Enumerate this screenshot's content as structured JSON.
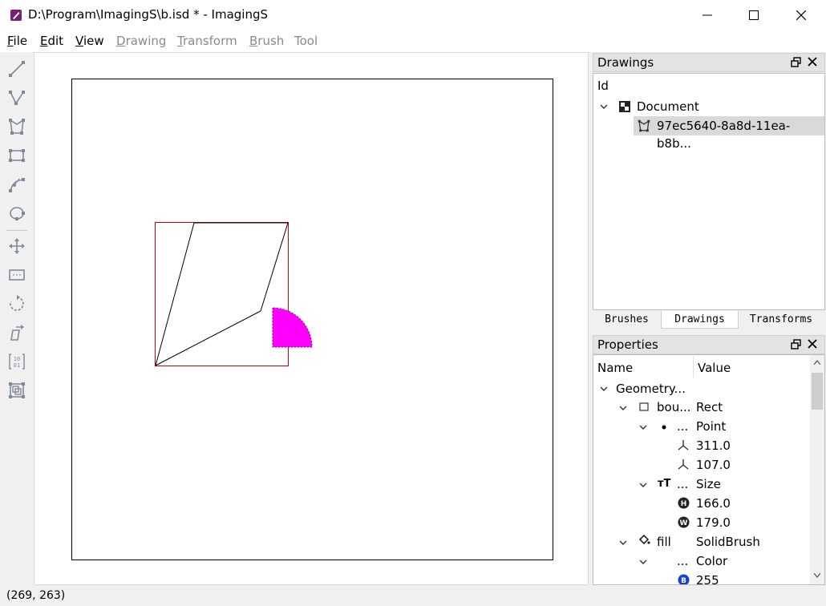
{
  "window": {
    "title": "D:\\Program\\ImagingS\\b.isd * - ImagingS"
  },
  "menu": {
    "items": [
      {
        "label": "File",
        "enabled": true
      },
      {
        "label": "Edit",
        "enabled": true
      },
      {
        "label": "View",
        "enabled": true
      },
      {
        "label": "Drawing",
        "enabled": false
      },
      {
        "label": "Transform",
        "enabled": false
      },
      {
        "label": "Brush",
        "enabled": false
      },
      {
        "label": "Tool",
        "enabled": false
      }
    ]
  },
  "toolbar": {
    "tools": [
      "line-tool-icon",
      "polyline-tool-icon",
      "polygon-tool-icon",
      "rectangle-tool-icon",
      "curve-tool-icon",
      "ellipse-tool-icon",
      "move-tool-icon",
      "clip-tool-icon",
      "rotate-tool-icon",
      "skew-tool-icon",
      "matrix-tool-icon",
      "transform-group-icon"
    ]
  },
  "canvas": {
    "selection_color": "#cc0000",
    "fill_color": "#ff00ff"
  },
  "status": {
    "coords": "(269, 263)"
  },
  "drawings_panel": {
    "title": "Drawings",
    "header": "Id",
    "root": "Document",
    "child": "97ec5640-8a8d-11ea-b8b..."
  },
  "tabs": [
    "Brushes",
    "Drawings",
    "Transforms"
  ],
  "active_tab": "Drawings",
  "properties_panel": {
    "title": "Properties",
    "col_name": "Name",
    "col_value": "Value",
    "rows": [
      {
        "name": "Geometry...",
        "value": ""
      },
      {
        "name": "bou...",
        "value": "Rect"
      },
      {
        "name": "...",
        "value": "Point"
      },
      {
        "name": "",
        "value": "311.0"
      },
      {
        "name": "",
        "value": "107.0"
      },
      {
        "name": "...",
        "value": "Size"
      },
      {
        "name": "",
        "value": "166.0"
      },
      {
        "name": "",
        "value": "179.0"
      },
      {
        "name": "fill",
        "value": "SolidBrush"
      },
      {
        "name": "...",
        "value": "Color"
      },
      {
        "name": "",
        "value": "255"
      }
    ]
  }
}
